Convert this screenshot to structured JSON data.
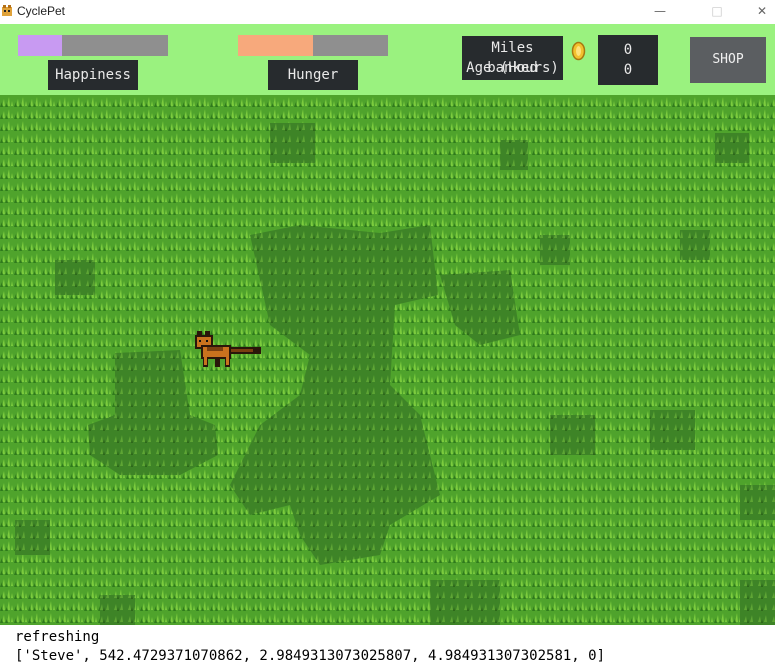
{
  "window": {
    "title": "CyclePet",
    "controls": {
      "minimize": "—",
      "maximize": "□",
      "close": "✕"
    }
  },
  "hud": {
    "happiness": {
      "label": "Happiness",
      "level": 0.29,
      "color": "#c89af2"
    },
    "hunger": {
      "label": "Hunger",
      "level": 0.5,
      "color": "#f7a97c"
    },
    "stats_labels": {
      "miles_banked": "Miles banked",
      "age_hours": "Age (Hours)"
    },
    "stats_values": {
      "miles_banked": "0",
      "age_hours": "0"
    },
    "coin_icon": "coin-icon",
    "shop_label": "SHOP"
  },
  "scene": {
    "pet": "fox-pet",
    "colors": {
      "grass": "#4fa32c",
      "path": "#3f8526",
      "pet": "#c8721e"
    }
  },
  "console": {
    "lines": [
      "refreshing",
      "['Steve', 542.4729371070862, 2.9849313073025807, 4.984931307302581, 0]"
    ]
  }
}
